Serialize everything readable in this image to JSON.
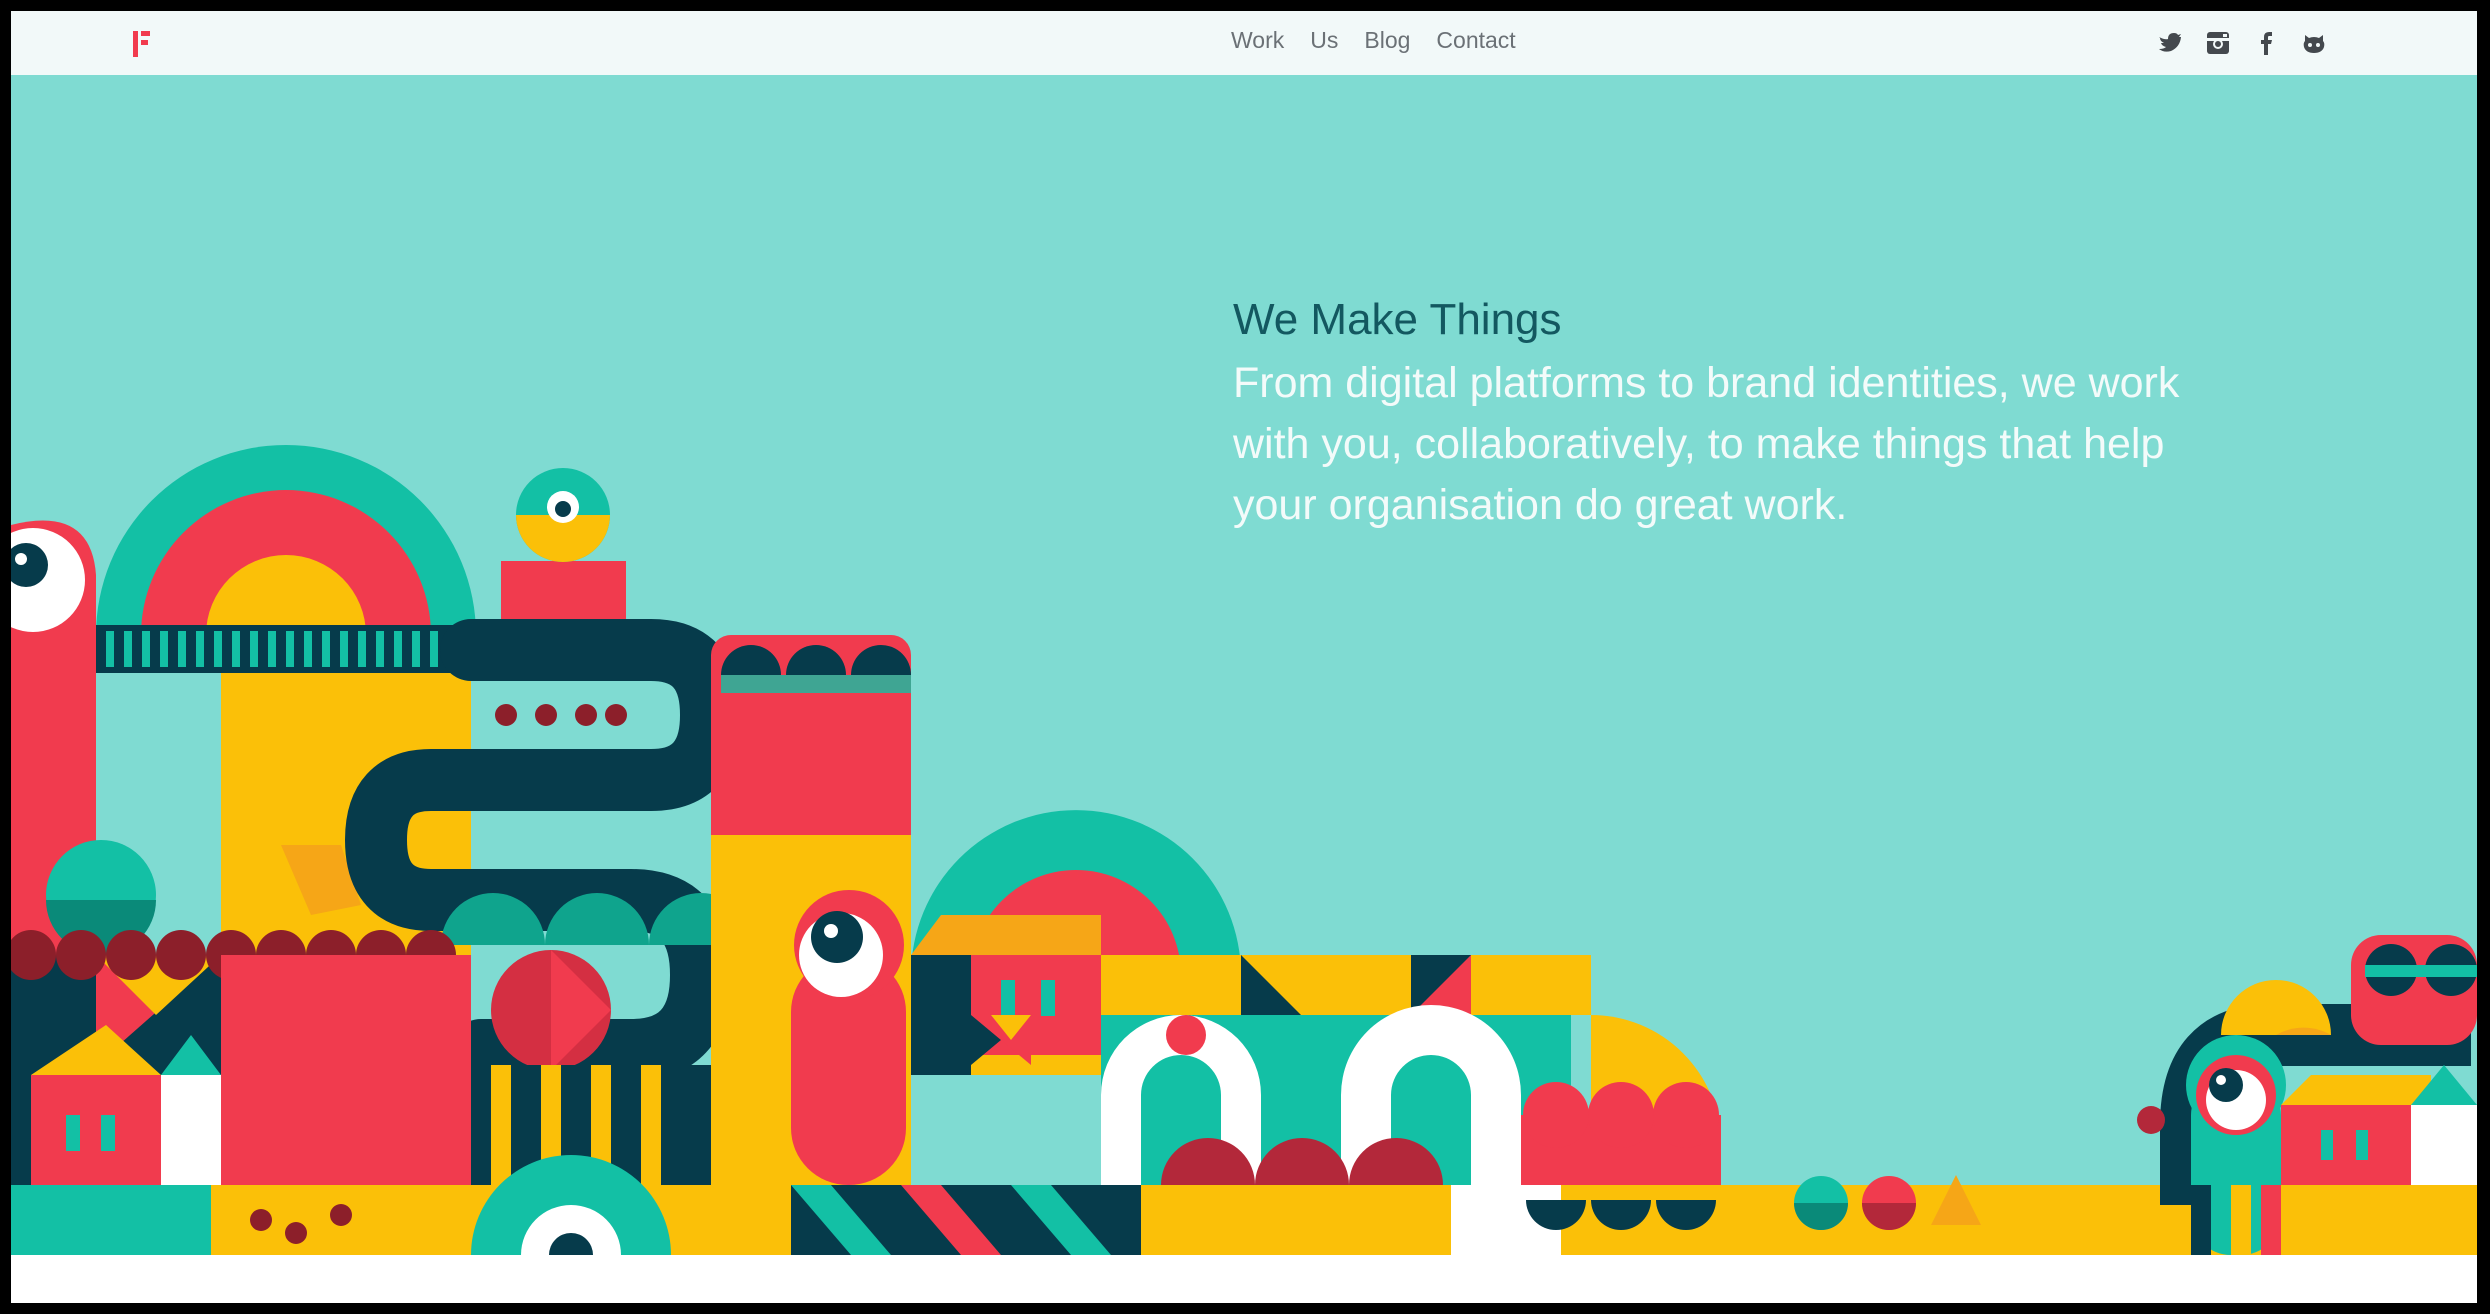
{
  "header": {
    "logo_letter": "F",
    "nav": [
      "Work",
      "Us",
      "Blog",
      "Contact"
    ],
    "social_icons": [
      "twitter-icon",
      "instagram-icon",
      "facebook-icon",
      "github-icon"
    ]
  },
  "hero": {
    "headline": "We Make Things",
    "subhead": "From digital platforms to brand identities, we work with you, collaboratively, to make things that help your organisation do great work."
  },
  "colors": {
    "teal_bg": "#7fdbd2",
    "red": "#f13b4e",
    "yellow": "#fbc008",
    "navy": "#063b4b",
    "green": "#13c0a5",
    "headline": "#135860"
  }
}
